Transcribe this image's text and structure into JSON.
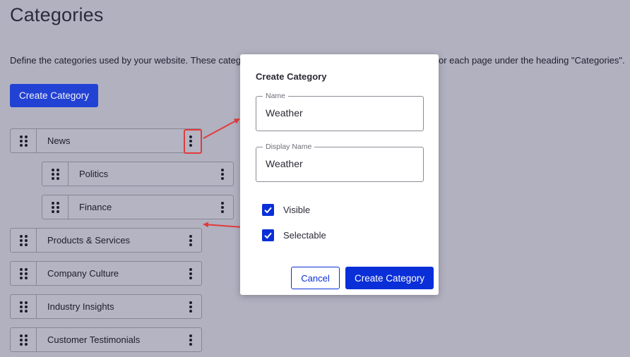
{
  "page": {
    "title": "Categories",
    "intro_left": "Define the categories used by your website. These categ",
    "intro_right": "or each page under the heading \"Categories\".",
    "create_button": "Create Category"
  },
  "categories": [
    {
      "label": "News"
    },
    {
      "label": "Politics"
    },
    {
      "label": "Finance"
    },
    {
      "label": "Products & Services"
    },
    {
      "label": "Company Culture"
    },
    {
      "label": "Industry Insights"
    },
    {
      "label": "Customer Testimonials"
    }
  ],
  "modal": {
    "title": "Create Category",
    "name_label": "Name",
    "name_value": "Weather",
    "display_name_label": "Display Name",
    "display_name_value": "Weather",
    "visible_label": "Visible",
    "visible_checked": true,
    "selectable_label": "Selectable",
    "selectable_checked": true,
    "cancel_button": "Cancel",
    "create_button": "Create Category"
  },
  "colors": {
    "overlay_background": "#b1b1c0",
    "primary": "#0a2fd8",
    "annotation_red": "#e23b3b"
  },
  "icons": {
    "drag": "drag-handle-icon",
    "menu": "kebab-menu-icon",
    "check": "check-icon"
  }
}
